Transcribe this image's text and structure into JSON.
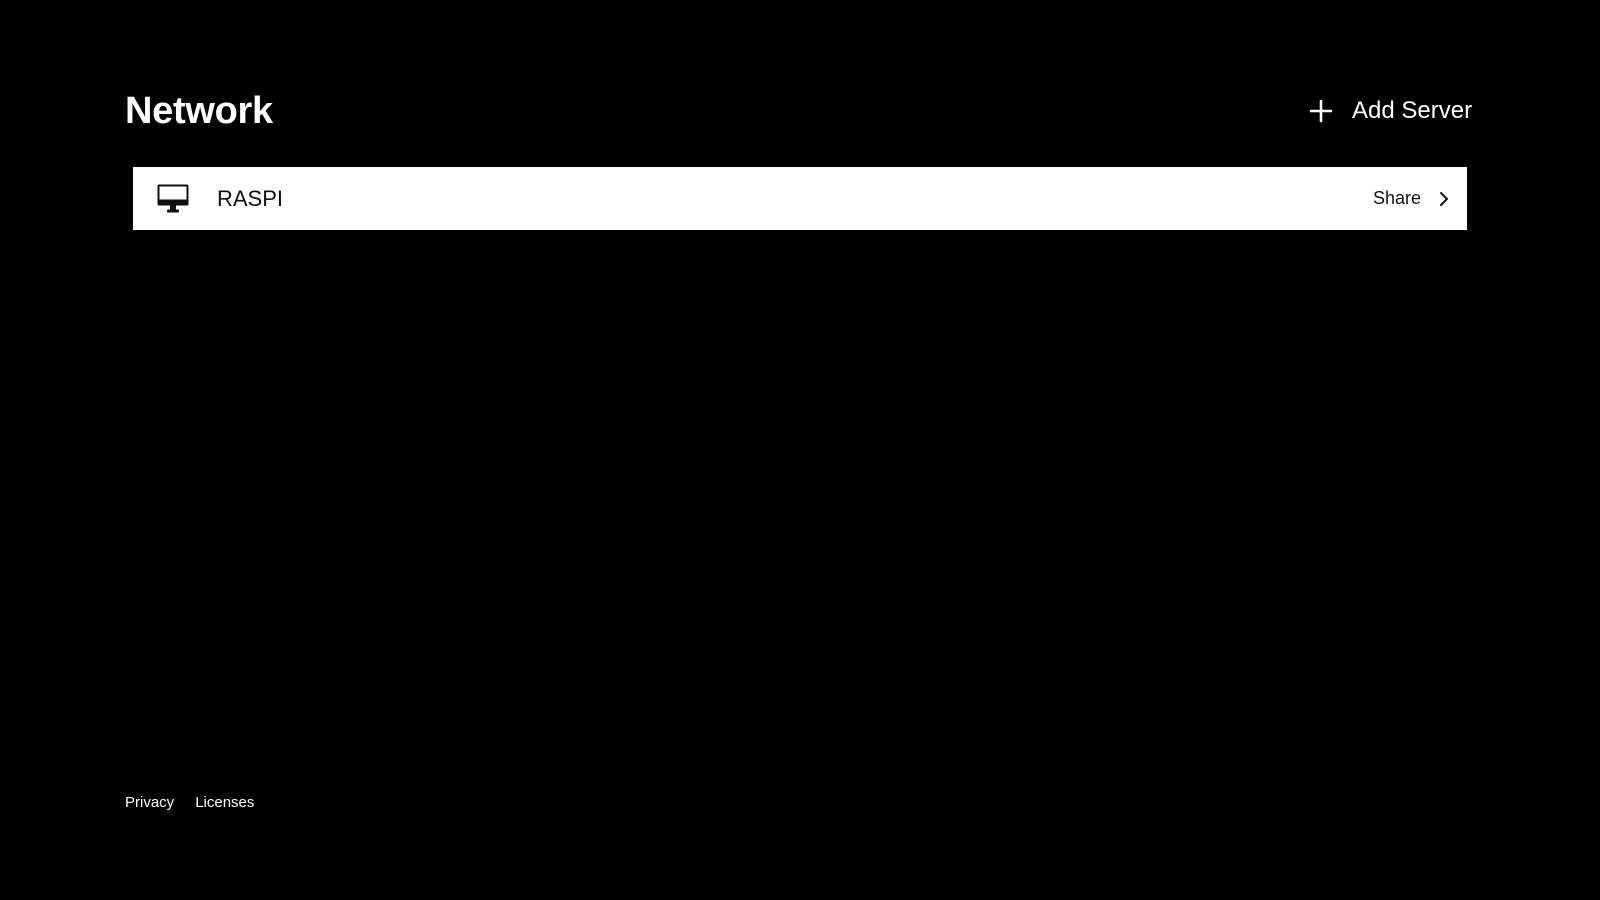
{
  "header": {
    "title": "Network",
    "add_server_label": "Add Server",
    "add_server_icon": "plus-icon"
  },
  "servers": [
    {
      "name": "RASPI",
      "icon": "computer-icon",
      "action_label": "Share",
      "action_icon": "chevron-right-icon"
    }
  ],
  "footer": {
    "links": [
      "Privacy",
      "Licenses"
    ]
  },
  "colors": {
    "background": "#000000",
    "text_on_dark": "#ffffff",
    "row_background": "#ffffff",
    "text_on_light": "#111111"
  }
}
